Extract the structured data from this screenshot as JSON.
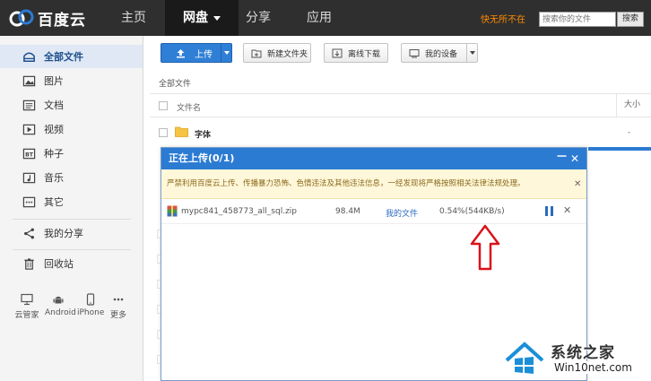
{
  "brand": {
    "name": "百度云"
  },
  "nav": {
    "items": [
      {
        "label": "主页"
      },
      {
        "label": "网盘"
      },
      {
        "label": "分享"
      },
      {
        "label": "应用"
      }
    ],
    "promo": "快无所不在",
    "search_placeholder": "搜索你的文件",
    "search_button": "搜索"
  },
  "sidebar": {
    "items": [
      {
        "label": "全部文件",
        "icon": "folder-icon"
      },
      {
        "label": "图片",
        "icon": "image-icon"
      },
      {
        "label": "文档",
        "icon": "document-icon"
      },
      {
        "label": "视频",
        "icon": "video-icon"
      },
      {
        "label": "种子",
        "icon": "bt-icon"
      },
      {
        "label": "音乐",
        "icon": "music-icon"
      },
      {
        "label": "其它",
        "icon": "more-icon"
      },
      {
        "label": "我的分享",
        "icon": "share-icon"
      },
      {
        "label": "回收站",
        "icon": "trash-icon"
      }
    ],
    "devices": [
      {
        "label": "云管家",
        "icon": "monitor-icon"
      },
      {
        "label": "Android",
        "icon": "android-icon"
      },
      {
        "label": "iPhone",
        "icon": "phone-icon"
      },
      {
        "label": "更多",
        "icon": "more-dots-icon"
      }
    ]
  },
  "toolbar": {
    "upload": "上传",
    "new_folder": "新建文件夹",
    "offline_download": "离线下载",
    "my_devices": "我的设备"
  },
  "breadcrumb": "全部文件",
  "file_list": {
    "col_name": "文件名",
    "col_size": "大小",
    "rows": [
      {
        "name": "字体",
        "size": "-"
      }
    ]
  },
  "upload_dialog": {
    "title": "正在上传(0/1)",
    "minimize": "－",
    "close": "✕",
    "warning": "严禁利用百度云上传、传播暴力恐怖、色情违法及其他违法信息，一经发现将严格按照相关法律法规处理。",
    "task": {
      "file": "mypc841_458773_all_sql.zip",
      "size": "98.4M",
      "destination": "我的文件",
      "progress": "0.54%(544KB/s)"
    }
  },
  "watermark": {
    "title": "系统之家",
    "url": "Win10net.com"
  },
  "colors": {
    "nav_bg": "#2f2f2f",
    "accent_blue": "#2b7bd3",
    "warning_bg": "#fff7d9",
    "arrow_red": "#d8141a"
  }
}
